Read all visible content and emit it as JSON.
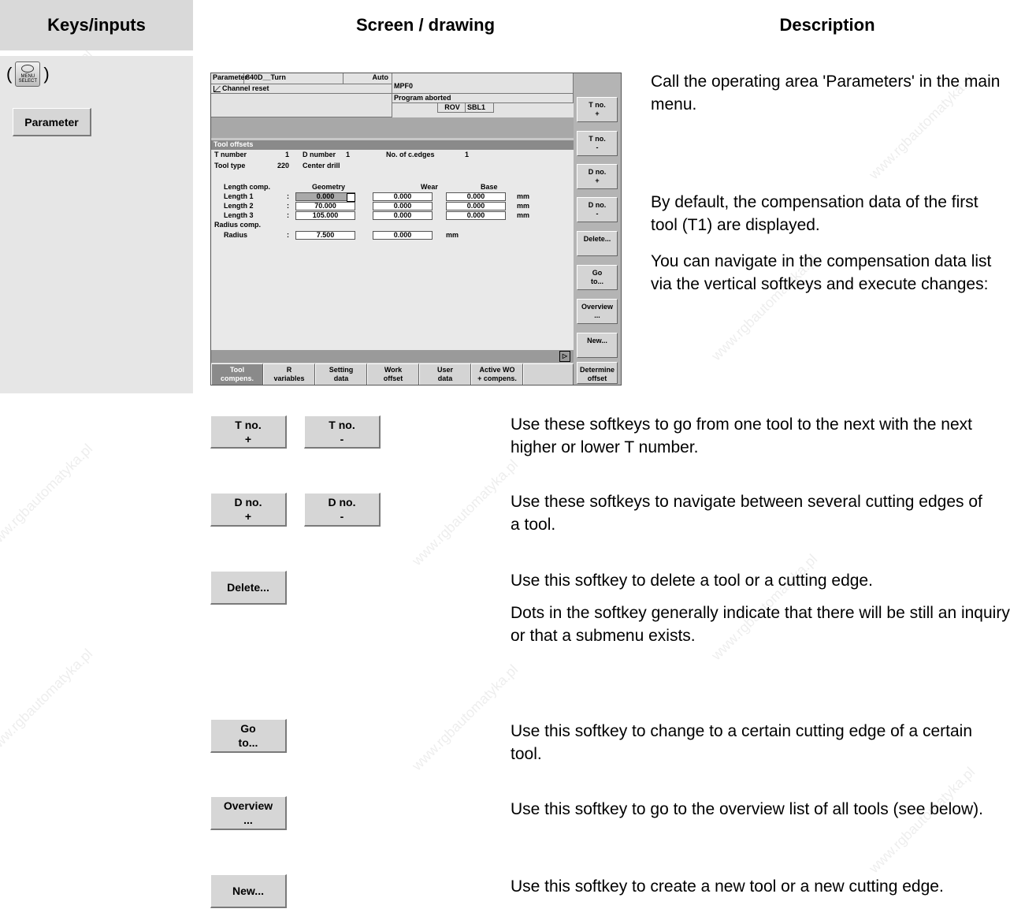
{
  "headers": {
    "keys": "Keys/inputs",
    "screen": "Screen / drawing",
    "description": "Description"
  },
  "keys": {
    "menu_key_text": "MENU\nSELECT",
    "open_paren": "(",
    "close_paren": ")",
    "parameter_button": "Parameter"
  },
  "screen": {
    "area": "Parameter",
    "machine": "840D__Turn",
    "mode": "Auto",
    "program": "MPF0",
    "channel_state": "Channel reset",
    "program_state": "Program aborted",
    "status_rov": "ROV",
    "status_sbl": "SBL1",
    "section_title": "Tool offsets",
    "t_number_label": "T number",
    "t_number_value": "1",
    "d_number_label": "D number",
    "d_number_value": "1",
    "edges_label": "No. of c.edges",
    "edges_value": "1",
    "tool_type_label": "Tool type",
    "tool_type_value": "220",
    "tool_type_name": "Center drill",
    "length_comp_label": "Length comp.",
    "col_geometry": "Geometry",
    "col_wear": "Wear",
    "col_base": "Base",
    "rows": [
      {
        "label": "Length 1",
        "colon": ":",
        "geometry": "0.000",
        "wear": "0.000",
        "base": "0.000",
        "unit": "mm"
      },
      {
        "label": "Length 2",
        "colon": ":",
        "geometry": "70.000",
        "wear": "0.000",
        "base": "0.000",
        "unit": "mm"
      },
      {
        "label": "Length 3",
        "colon": ":",
        "geometry": "105.000",
        "wear": "0.000",
        "base": "0.000",
        "unit": "mm"
      }
    ],
    "radius_comp_label": "Radius comp.",
    "radius_label": "Radius",
    "radius_colon": ":",
    "radius_geometry": "7.500",
    "radius_wear": "0.000",
    "radius_unit": "mm",
    "page_arrow": "▷",
    "vertical_softkeys": [
      "T no.\n+",
      "T no.\n-",
      "D no.\n+",
      "D no.\n-",
      "Delete...",
      "Go\nto...",
      "Overview\n...",
      "New...",
      "Determine\noffset"
    ],
    "horizontal_softkeys": [
      "Tool\ncompens.",
      "R\nvariables",
      "Setting\ndata",
      "Work\noffset",
      "User\ndata",
      "Active WO\n+ compens.",
      ""
    ]
  },
  "softkey_examples": {
    "t_plus": "T no.\n+",
    "t_minus": "T no.\n-",
    "d_plus": "D no.\n+",
    "d_minus": "D no.\n-",
    "delete": "Delete...",
    "goto": "Go\nto...",
    "overview": "Overview\n...",
    "new": "New..."
  },
  "descriptions": {
    "call_area": "Call the operating area 'Parameters' in the main menu.",
    "default": "By default, the compensation data of the first tool (T1) are displayed.",
    "navigate": "You can navigate in the compensation data list via the vertical softkeys and execute changes:",
    "t_keys": "Use these softkeys to go from one tool to the next with the next higher or lower T number.",
    "d_keys": "Use these softkeys to navigate between several cutting edges of a tool.",
    "delete": "Use this softkey to delete a tool or a cutting edge.",
    "dots": "Dots in the softkey generally indicate that there will be still an inquiry or that a submenu exists.",
    "goto": "Use this softkey to change to a certain cutting edge of a certain tool.",
    "overview": "Use this softkey to go to the overview list of all tools (see below).",
    "new": "Use this softkey to create a new tool or a new cutting edge."
  },
  "watermark": "www.rgbautomatyka.pl"
}
